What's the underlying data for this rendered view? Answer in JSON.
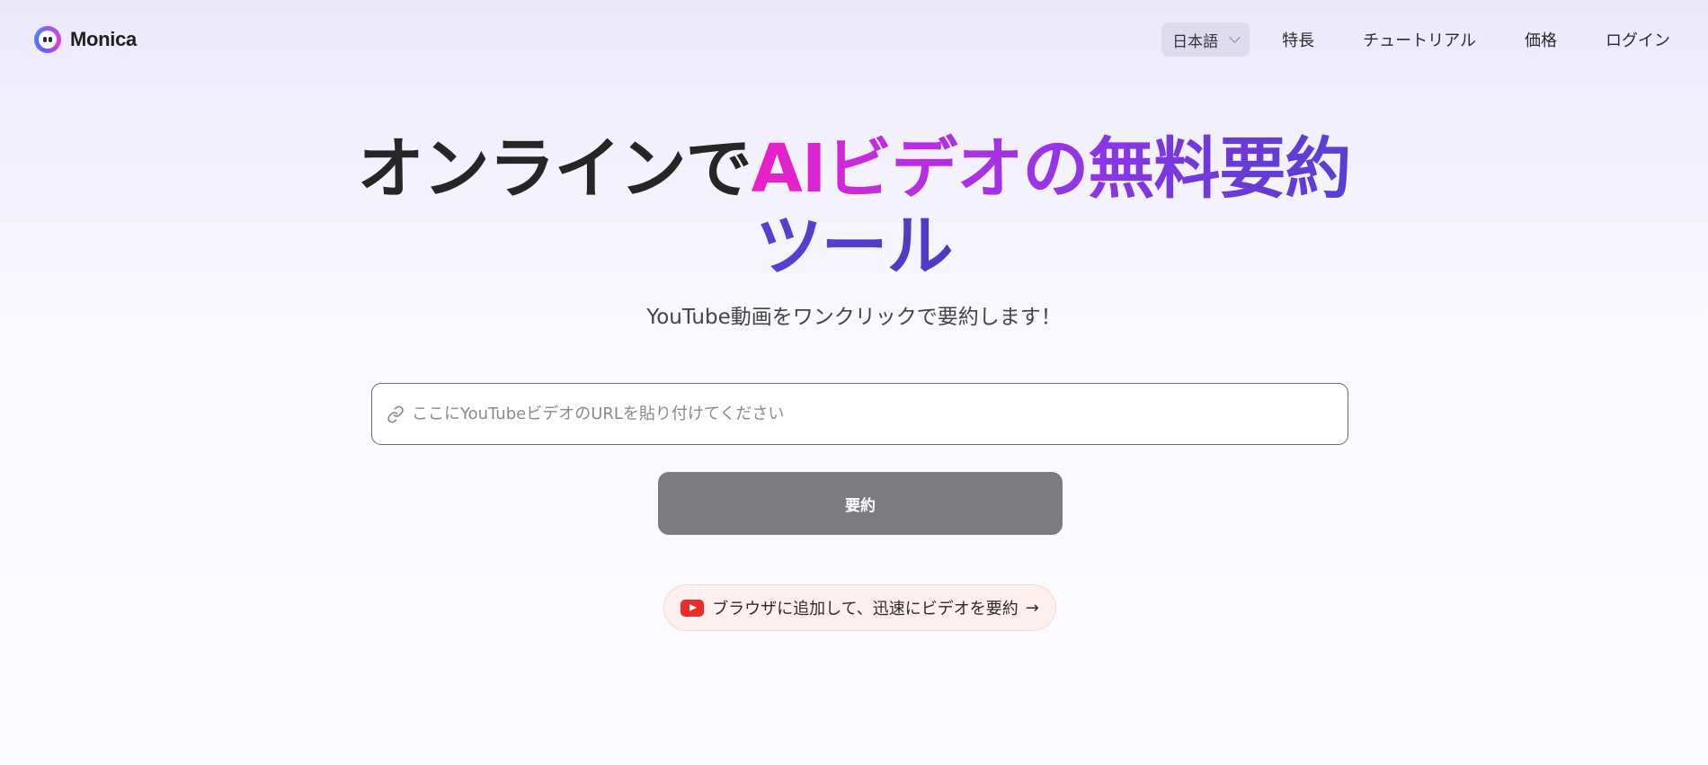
{
  "header": {
    "logo_text": "Monica",
    "language_selector": {
      "value": "日本語"
    },
    "nav": [
      {
        "label": "特長"
      },
      {
        "label": "チュートリアル"
      },
      {
        "label": "価格"
      },
      {
        "label": "ログイン"
      }
    ]
  },
  "hero": {
    "title_part1": "オンラインで",
    "title_part2": "AIビデオの無料要約",
    "title_part3": "ツール",
    "subtitle": "YouTube動画をワンクリックで要約します！"
  },
  "url_input": {
    "placeholder": "ここにYouTubeビデオのURLを貼り付けてください",
    "value": ""
  },
  "summarize_button": {
    "label": "要約"
  },
  "extension_promo": {
    "text": "ブラウザに追加して、迅速にビデオを要約",
    "arrow": "→"
  },
  "icons": {
    "link": "link-icon",
    "youtube": "youtube-icon",
    "chevron": "chevron-down-icon",
    "arrow": "arrow-right-icon"
  },
  "colors": {
    "accent_pink": "#ee1ec5",
    "accent_purple": "#5a3ed2",
    "button_gray": "#7b7b80",
    "youtube_red": "#ee2b2b",
    "promo_bg": "#fdf0ee"
  }
}
